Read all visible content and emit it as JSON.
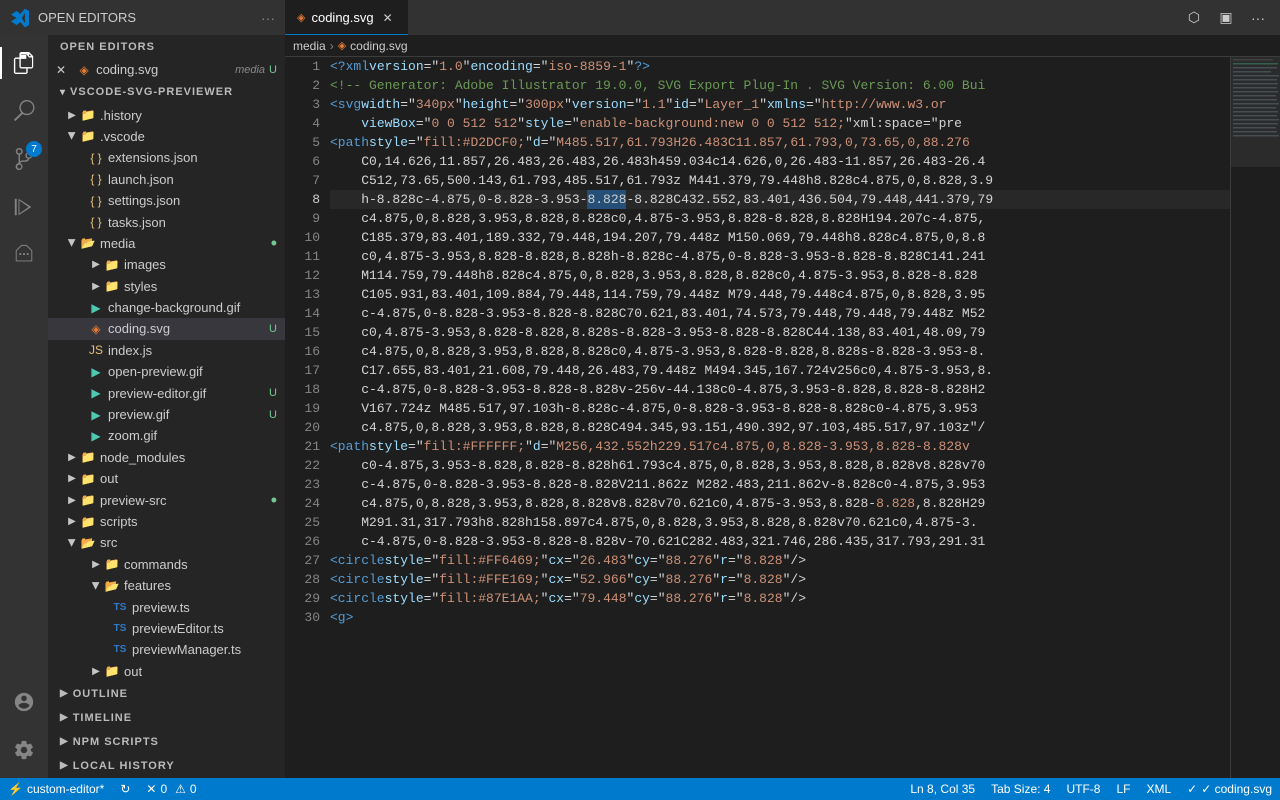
{
  "titleBar": {
    "title": "coding.svg",
    "tabs": [
      {
        "name": "coding.svg",
        "active": true,
        "modified": false
      }
    ],
    "icons": [
      "split-editor",
      "customize-layout",
      "more-actions"
    ]
  },
  "activityBar": {
    "items": [
      {
        "id": "explorer",
        "icon": "📄",
        "active": true,
        "badge": null
      },
      {
        "id": "search",
        "icon": "🔍",
        "active": false,
        "badge": null
      },
      {
        "id": "source-control",
        "icon": "⑂",
        "active": false,
        "badge": "7"
      },
      {
        "id": "run",
        "icon": "▷",
        "active": false,
        "badge": null
      },
      {
        "id": "extensions",
        "icon": "⊞",
        "active": false,
        "badge": null
      }
    ],
    "bottomItems": [
      {
        "id": "accounts",
        "icon": "👤"
      },
      {
        "id": "settings",
        "icon": "⚙"
      }
    ]
  },
  "sidebar": {
    "openEditors": {
      "header": "OPEN EDITORS",
      "items": [
        {
          "name": "coding.svg",
          "badge": "U",
          "type": "svg",
          "close": true
        }
      ]
    },
    "explorer": {
      "header": "VSCODE-SVG-PREVIEWER",
      "items": [
        {
          "name": ".history",
          "type": "folder",
          "depth": 1,
          "open": false
        },
        {
          "name": ".vscode",
          "type": "folder",
          "depth": 1,
          "open": false
        },
        {
          "name": "extensions.json",
          "type": "json",
          "depth": 2
        },
        {
          "name": "launch.json",
          "type": "json",
          "depth": 2
        },
        {
          "name": "settings.json",
          "type": "json",
          "depth": 2
        },
        {
          "name": "tasks.json",
          "type": "json",
          "depth": 2
        },
        {
          "name": "media",
          "type": "folder",
          "depth": 1,
          "open": true,
          "badge": "dot"
        },
        {
          "name": "images",
          "type": "folder",
          "depth": 2,
          "open": false
        },
        {
          "name": "styles",
          "type": "folder",
          "depth": 2,
          "open": false
        },
        {
          "name": "change-background.gif",
          "type": "gif",
          "depth": 2
        },
        {
          "name": "coding.svg",
          "type": "svg",
          "depth": 2,
          "badge": "U",
          "selected": true
        },
        {
          "name": "index.js",
          "type": "js",
          "depth": 2
        },
        {
          "name": "open-preview.gif",
          "type": "gif",
          "depth": 2
        },
        {
          "name": "preview-editor.gif",
          "type": "gif",
          "depth": 2,
          "badge": "U"
        },
        {
          "name": "preview.gif",
          "type": "gif",
          "depth": 2,
          "badge": "U"
        },
        {
          "name": "zoom.gif",
          "type": "gif",
          "depth": 2
        },
        {
          "name": "node_modules",
          "type": "folder",
          "depth": 1,
          "open": false
        },
        {
          "name": "out",
          "type": "folder",
          "depth": 1,
          "open": false
        },
        {
          "name": "preview-src",
          "type": "folder",
          "depth": 1,
          "open": false,
          "badge": "dot"
        },
        {
          "name": "scripts",
          "type": "folder",
          "depth": 1,
          "open": false
        },
        {
          "name": "src",
          "type": "folder",
          "depth": 1,
          "open": true
        },
        {
          "name": "commands",
          "type": "folder",
          "depth": 2,
          "open": false
        },
        {
          "name": "features",
          "type": "folder",
          "depth": 2,
          "open": true
        },
        {
          "name": "preview.ts",
          "type": "ts",
          "depth": 3
        },
        {
          "name": "previewEditor.ts",
          "type": "ts",
          "depth": 3
        },
        {
          "name": "previewManager.ts",
          "type": "ts",
          "depth": 3
        },
        {
          "name": "out",
          "type": "folder",
          "depth": 2,
          "open": false
        }
      ]
    },
    "outline": {
      "header": "OUTLINE"
    },
    "timeline": {
      "header": "TIMELINE"
    },
    "npmScripts": {
      "header": "NPM SCRIPTS"
    },
    "localHistory": {
      "header": "LOCAL HISTORY"
    }
  },
  "breadcrumb": {
    "items": [
      "media",
      "coding.svg"
    ]
  },
  "editor": {
    "filename": "coding.svg",
    "lines": [
      {
        "num": 1,
        "content": "xml_declaration"
      },
      {
        "num": 2,
        "content": "comment"
      },
      {
        "num": 3,
        "content": "svg_open"
      },
      {
        "num": 4,
        "content": "viewBox"
      },
      {
        "num": 5,
        "content": "path1"
      },
      {
        "num": 6,
        "content": "path1_d1"
      },
      {
        "num": 7,
        "content": "path1_d2"
      },
      {
        "num": 8,
        "content": "path1_d3"
      },
      {
        "num": 9,
        "content": "path1_d4"
      },
      {
        "num": 10,
        "content": "path1_d5"
      },
      {
        "num": 11,
        "content": "path1_d6"
      },
      {
        "num": 12,
        "content": "path1_d7"
      },
      {
        "num": 13,
        "content": "path1_d8"
      },
      {
        "num": 14,
        "content": "path1_d9"
      },
      {
        "num": 15,
        "content": "path1_d10"
      },
      {
        "num": 16,
        "content": "path1_d11"
      },
      {
        "num": 17,
        "content": "path1_d12"
      },
      {
        "num": 18,
        "content": "path1_d13"
      },
      {
        "num": 19,
        "content": "path1_d14"
      },
      {
        "num": 20,
        "content": "path1_d15"
      },
      {
        "num": 21,
        "content": "path2"
      },
      {
        "num": 22,
        "content": "path2_d1"
      },
      {
        "num": 23,
        "content": "path2_d2"
      },
      {
        "num": 24,
        "content": "path2_d3"
      },
      {
        "num": 25,
        "content": "path2_d4"
      },
      {
        "num": 26,
        "content": "path2_d5"
      },
      {
        "num": 27,
        "content": "circle1"
      },
      {
        "num": 28,
        "content": "circle2"
      },
      {
        "num": 29,
        "content": "circle3"
      },
      {
        "num": 30,
        "content": "g_open"
      }
    ]
  },
  "statusBar": {
    "left": [
      {
        "id": "branch",
        "text": "custom-editor*",
        "icon": "⚡"
      },
      {
        "id": "sync",
        "text": "",
        "icon": "↻"
      },
      {
        "id": "errors",
        "text": "0",
        "icon": "✕"
      },
      {
        "id": "warnings",
        "text": "0",
        "icon": "⚠"
      }
    ],
    "right": [
      {
        "id": "cursor-pos",
        "text": "Ln 8, Col 35"
      },
      {
        "id": "tab-size",
        "text": "Tab Size: 4"
      },
      {
        "id": "encoding",
        "text": "UTF-8"
      },
      {
        "id": "line-ending",
        "text": "LF"
      },
      {
        "id": "language",
        "text": "XML"
      },
      {
        "id": "validation",
        "text": "✓ coding.svg",
        "icon": "xml"
      }
    ]
  }
}
